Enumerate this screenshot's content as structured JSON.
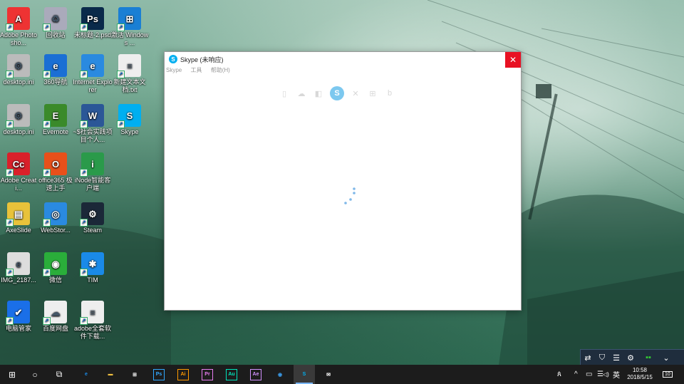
{
  "desktop": {
    "icons": [
      {
        "label": "Adobe Photosho...",
        "glyph": "A",
        "color": "#e33"
      },
      {
        "label": "回收站",
        "glyph": "♻",
        "color": "#aab"
      },
      {
        "label": "未标题-2.psd",
        "glyph": "Ps",
        "color": "#0a2a4a"
      },
      {
        "label": "激活 Windows ...",
        "glyph": "⊞",
        "color": "#1a7fd4"
      },
      {
        "label": "desktop.ini",
        "glyph": "⚙",
        "color": "#bbb"
      },
      {
        "label": "360导航",
        "glyph": "e",
        "color": "#1a6fd4"
      },
      {
        "label": "Internet Explorer",
        "glyph": "e",
        "color": "#2a8ae0"
      },
      {
        "label": "新建文本文档.txt",
        "glyph": "≡",
        "color": "#eee"
      },
      {
        "label": "desktop.ini",
        "glyph": "⚙",
        "color": "#bbb"
      },
      {
        "label": "Evernote",
        "glyph": "E",
        "color": "#3a8a2a"
      },
      {
        "label": "~$社会实践项目个人...",
        "glyph": "W",
        "color": "#2b5797"
      },
      {
        "label": "Skype",
        "glyph": "S",
        "color": "#00aff0"
      },
      {
        "label": "Adobe Creati...",
        "glyph": "Cc",
        "color": "#d9202a"
      },
      {
        "label": "office365 极速上手",
        "glyph": "O",
        "color": "#e8501a"
      },
      {
        "label": "iNode智能客户端",
        "glyph": "i",
        "color": "#2a9a4a"
      },
      {
        "label": "AxeSlide",
        "glyph": "▤",
        "color": "#e8c23a"
      },
      {
        "label": "WebStor...",
        "glyph": "◎",
        "color": "#2a8ae0"
      },
      {
        "label": "Steam",
        "glyph": "⚙",
        "color": "#1b2838"
      },
      {
        "label": "IMG_2187...",
        "glyph": "e",
        "color": "#ddd"
      },
      {
        "label": "微信",
        "glyph": "◉",
        "color": "#2aae3a"
      },
      {
        "label": "TIM",
        "glyph": "✱",
        "color": "#1a8ae8"
      },
      {
        "label": "电脑管家",
        "glyph": "✔",
        "color": "#1a6fe8"
      },
      {
        "label": "百度网盘",
        "glyph": "☁",
        "color": "#eee"
      },
      {
        "label": "adobe全套软件下载...",
        "glyph": "≡",
        "color": "#eee"
      }
    ]
  },
  "skype_window": {
    "title": "Skype (未响应)",
    "close_symbol": "✕",
    "menu": [
      "Skype",
      "工具",
      "帮助(H)"
    ],
    "loading_icons": [
      "▯",
      "☁",
      "◧",
      "S",
      "✕",
      "⊞",
      "b"
    ]
  },
  "tray_flyout": {
    "icons": [
      "⇄",
      "⛉",
      "☰",
      "⚙",
      "▪▪",
      "⌄"
    ]
  },
  "taskbar": {
    "start_icon": "⊞",
    "search_icon": "○",
    "taskview_icon": "⧉",
    "apps": [
      {
        "name": "edge",
        "glyph": "e",
        "color": "#1a8ae8"
      },
      {
        "name": "explorer",
        "glyph": "▬",
        "color": "#f0c040"
      },
      {
        "name": "store",
        "glyph": "⊞",
        "color": "#fff"
      },
      {
        "name": "ps",
        "glyph": "Ps",
        "color": "#31a8ff"
      },
      {
        "name": "ai",
        "glyph": "Ai",
        "color": "#ff9a00"
      },
      {
        "name": "pr",
        "glyph": "Pr",
        "color": "#e77cf0"
      },
      {
        "name": "au",
        "glyph": "Au",
        "color": "#00e4bb"
      },
      {
        "name": "ae",
        "glyph": "Ae",
        "color": "#d291ff"
      },
      {
        "name": "browser",
        "glyph": "◉",
        "color": "#3a9ae8"
      },
      {
        "name": "skype",
        "glyph": "S",
        "color": "#00aff0"
      },
      {
        "name": "mail",
        "glyph": "✉",
        "color": "#fff"
      }
    ],
    "tray": {
      "people_icon": "ጰ",
      "chevron_icon": "^",
      "battery_icon": "▭",
      "network_icon": "☰",
      "volume_icon": "◁)",
      "ime": "英",
      "time": "10:58",
      "date": "2018/5/15",
      "notifications_count": "10"
    }
  }
}
